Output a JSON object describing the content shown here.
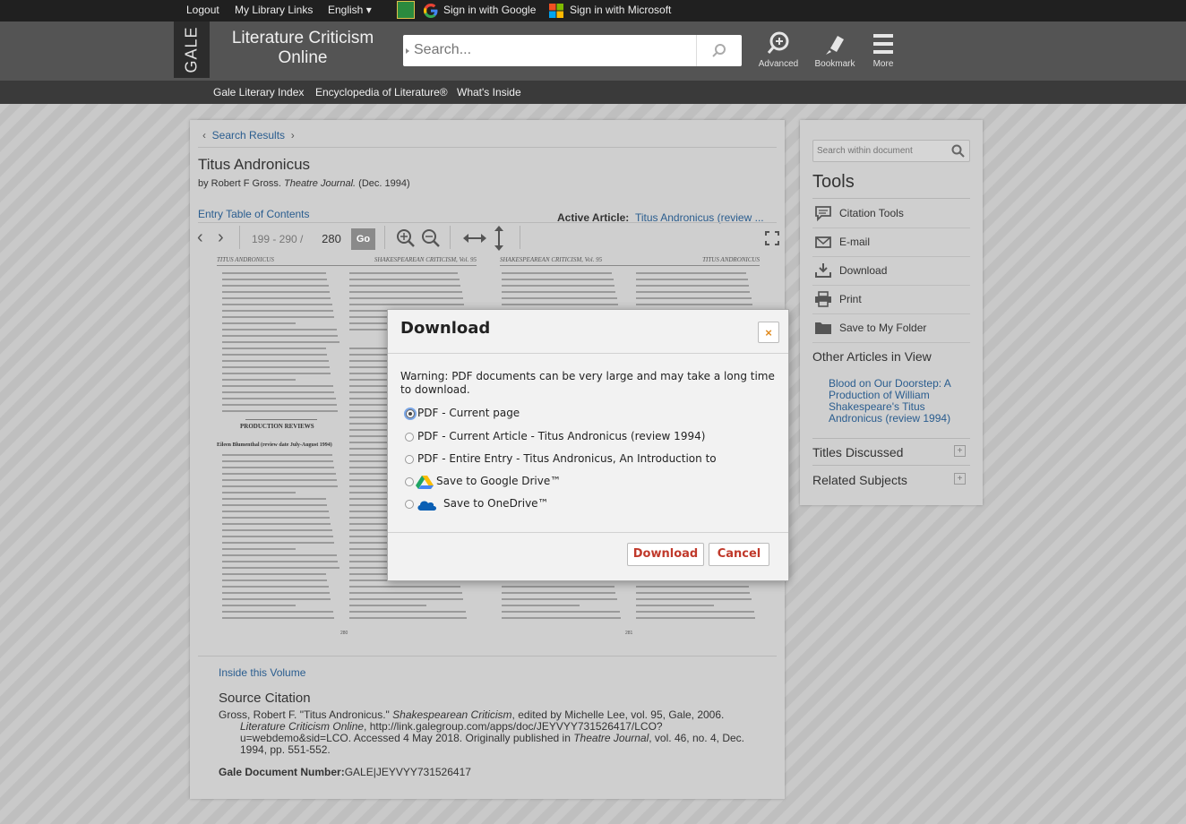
{
  "topbar": {
    "logout": "Logout",
    "my_library_links": "My Library Links",
    "language": "English",
    "sign_in_google": "Sign in with Google",
    "sign_in_microsoft": "Sign in with Microsoft"
  },
  "header": {
    "logo": "GALE",
    "title_line1": "Literature Criticism",
    "title_line2": "Online",
    "search_placeholder": "Search...",
    "tools": {
      "advanced": "Advanced",
      "bookmark": "Bookmark",
      "more": "More"
    }
  },
  "subnav": [
    "Gale Literary Index",
    "Encyclopedia of Literature®",
    "What's Inside"
  ],
  "article": {
    "breadcrumb": "Search Results",
    "title": "Titus Andronicus",
    "byline_prefix": "by Robert F Gross. ",
    "byline_journal": "Theatre Journal.",
    "byline_suffix": " (Dec. 1994)",
    "entry_toc": "Entry Table of Contents",
    "active_article_label": "Active Article:",
    "active_article_value": "Titus Andronicus (review ...",
    "page_range": "199 - 290 /",
    "page_value": "280",
    "go": "Go"
  },
  "document": {
    "left_header_left": "TITUS ANDRONICUS",
    "left_header_right": "SHAKESPEAREAN CRITICISM, Vol. 95",
    "right_header_left": "SHAKESPEAREAN CRITICISM, Vol. 95",
    "right_header_right": "TITUS ANDRONICUS",
    "section_heading": "PRODUCTION REVIEWS",
    "review_byline": "Eileen Blumenthal (review date July-August 1994)",
    "page_left": "280",
    "page_right": "281"
  },
  "source": {
    "inside_volume": "Inside this Volume",
    "heading": "Source Citation",
    "line1_prefix": "Gross, Robert F. \"Titus Andronicus.\" ",
    "line1_italic": "Shakespearean Criticism",
    "line1_suffix": ", edited by Michelle Lee, vol. 95, Gale, 2006.",
    "line2_italic": "Literature Criticism Online",
    "line2_suffix": ", http://link.galegroup.com/apps/doc/JEYVYY731526417/LCO?",
    "line3_prefix": "u=webdemo&sid=LCO. Accessed 4 May 2018. Originally published in ",
    "line3_italic": "Theatre Journal",
    "line3_suffix": ", vol. 46, no. 4, Dec.",
    "line4": "1994, pp. 551-552.",
    "docnum_label": "Gale Document Number:",
    "docnum_value": "GALE|JEYVYY731526417"
  },
  "sidebar": {
    "search_placeholder": "Search within document",
    "tools_heading": "Tools",
    "tools": [
      "Citation Tools",
      "E-mail",
      "Download",
      "Print",
      "Save to My Folder"
    ],
    "other_articles_heading": "Other Articles in View",
    "other_article_link": "Blood on Our Doorstep: A Production of William Shakespeare's Titus Andronicus (review 1994)",
    "titles_discussed": "Titles Discussed",
    "related_subjects": "Related Subjects"
  },
  "modal": {
    "title": "Download",
    "close": "×",
    "warning": "Warning: PDF documents can be very large and may take a long time to download.",
    "options": [
      "PDF - Current page",
      "PDF - Current Article - Titus Andronicus (review 1994)",
      "PDF - Entire Entry - Titus Andronicus, An Introduction to",
      "Save to Google Drive™",
      "Save to OneDrive™"
    ],
    "selected_option": "PDF - Current page",
    "download_button": "Download",
    "cancel_button": "Cancel"
  }
}
